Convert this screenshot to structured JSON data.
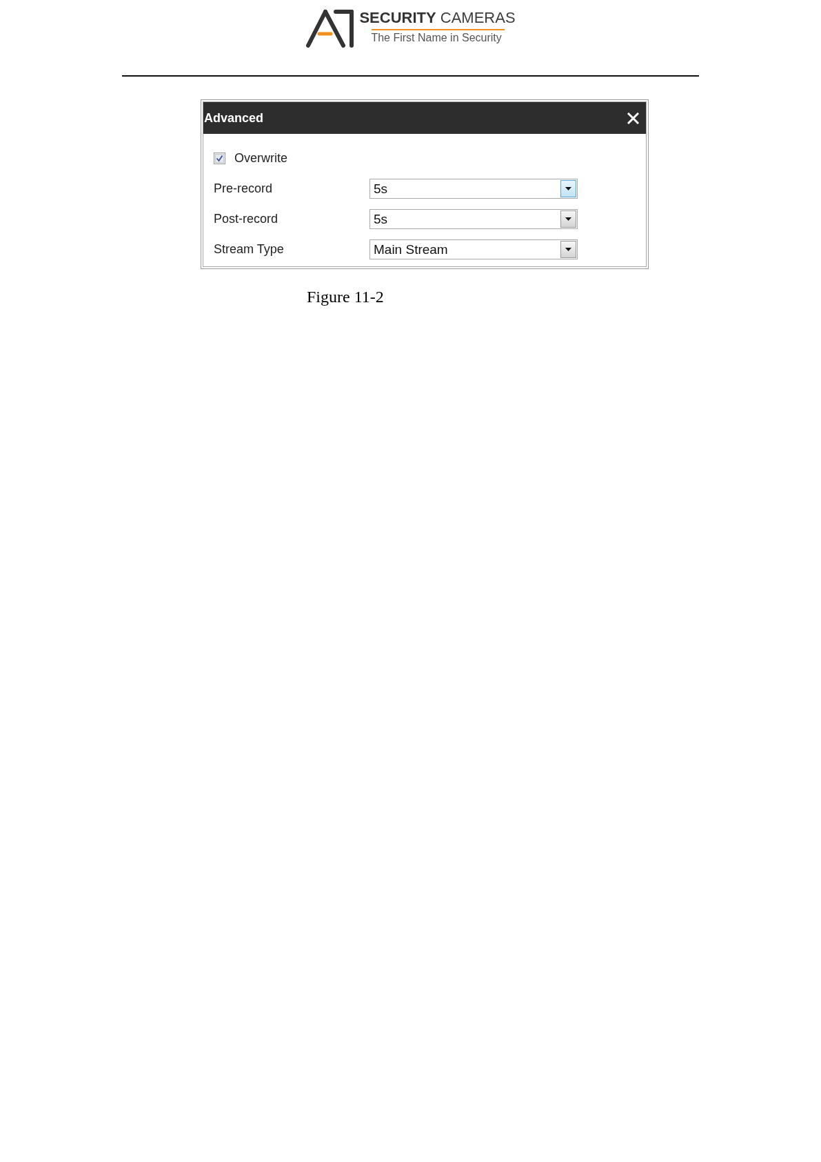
{
  "logo": {
    "brand": "**SECURITY** CAMERAS",
    "tagline": "The First Name in Security"
  },
  "dialog": {
    "title": "Advanced",
    "overwrite": {
      "label": "Overwrite",
      "checked": true
    },
    "fields": [
      {
        "label": "Pre-record",
        "value": "5s",
        "focused": true
      },
      {
        "label": "Post-record",
        "value": "5s",
        "focused": false
      },
      {
        "label": "Stream Type",
        "value": "Main Stream",
        "focused": false
      }
    ]
  },
  "caption": "Figure 11-2"
}
